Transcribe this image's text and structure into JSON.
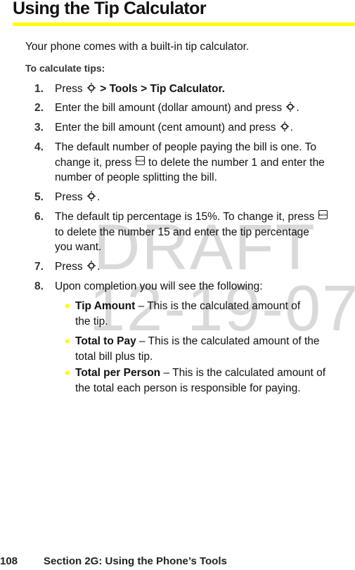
{
  "watermark": {
    "line1": "DRAFT",
    "line2": "12-19-07"
  },
  "page": {
    "title": "Using the Tip Calculator",
    "intro": "Your phone comes with a built-in tip calculator.",
    "subhead": "To calculate tips:",
    "accent_color": "#ffff00"
  },
  "steps": [
    {
      "num": "1.",
      "lines": [
        {
          "pre": "Press ",
          "key": "nav-key",
          "post": "",
          "bold": " > Tools > Tip Calculator."
        }
      ]
    },
    {
      "num": "2.",
      "lines": [
        {
          "pre": "Enter the bill amount (dollar amount) and press ",
          "key": "nav-key",
          "post": "."
        }
      ]
    },
    {
      "num": "3.",
      "lines": [
        {
          "pre": "Enter the bill amount (cent amount) and press ",
          "key": "nav-key",
          "post": "."
        }
      ]
    },
    {
      "num": "4.",
      "lines": [
        {
          "text": "The default number of people paying the bill is one. To"
        },
        {
          "pre": "change it, press ",
          "key": "back-key",
          "post": " to delete the number 1 and enter the"
        },
        {
          "text": "number of people splitting the bill."
        }
      ]
    },
    {
      "num": "5.",
      "lines": [
        {
          "pre": "Press ",
          "key": "nav-key",
          "post": "."
        }
      ]
    },
    {
      "num": "6.",
      "lines": [
        {
          "pre": "The default tip percentage is 15%. To change it, press ",
          "key": "back-key",
          "post": ""
        },
        {
          "text": "to delete the number 15 and enter the tip percentage"
        },
        {
          "text": "you want."
        }
      ]
    },
    {
      "num": "7.",
      "lines": [
        {
          "pre": "Press ",
          "key": "nav-key",
          "post": "."
        }
      ]
    },
    {
      "num": "8.",
      "lines": [
        {
          "text": "Upon completion you will see the following:"
        }
      ]
    }
  ],
  "back_key_label": "BACK",
  "bullets": [
    {
      "term": "Tip Amount",
      "lines": [
        "– This is the calculated amount of",
        "the tip."
      ]
    },
    {
      "term": "Total to Pay",
      "lines": [
        "– This is the calculated amount of the",
        "total bill plus tip."
      ]
    },
    {
      "term": "Total per Person",
      "lines": [
        "– This is the calculated amount of",
        "the total each person is responsible for paying."
      ]
    }
  ],
  "footer": {
    "page_number": "108",
    "section": "Section 2G: Using the Phone’s Tools"
  }
}
